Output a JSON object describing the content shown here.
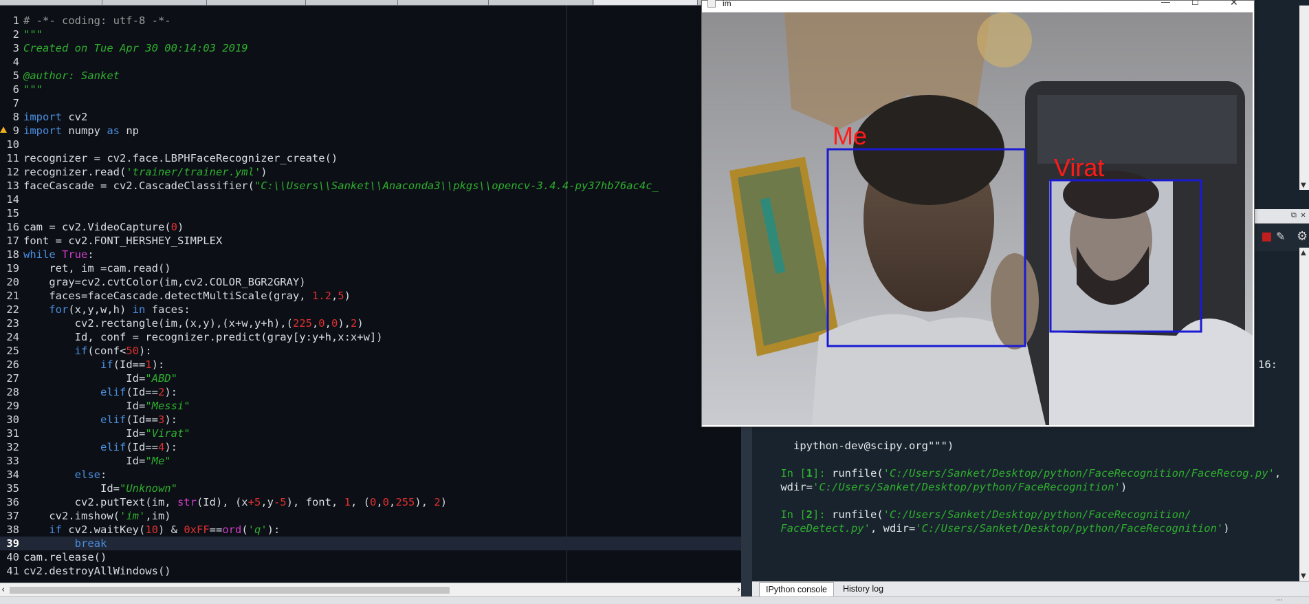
{
  "editor": {
    "current_line": 39,
    "lines": [
      {
        "n": "1",
        "html": "<span class=\"c\"># -*- coding: utf-8 -*-</span>"
      },
      {
        "n": "2",
        "html": "<span class=\"s\">\"\"\"</span>"
      },
      {
        "n": "3",
        "html": "<span class=\"s\">Created on Tue Apr 30 00:14:03 2019</span>"
      },
      {
        "n": "4",
        "html": ""
      },
      {
        "n": "5",
        "html": "<span class=\"s\">@author: Sanket</span>"
      },
      {
        "n": "6",
        "html": "<span class=\"s\">\"\"\"</span>"
      },
      {
        "n": "7",
        "html": ""
      },
      {
        "n": "8",
        "html": "<span class=\"k\">import</span> cv2"
      },
      {
        "n": "9",
        "html": "<span class=\"k\">import</span> numpy <span class=\"k\">as</span> np"
      },
      {
        "n": "10",
        "html": ""
      },
      {
        "n": "11",
        "html": "recognizer = cv2.face.LBPHFaceRecognizer_create()"
      },
      {
        "n": "12",
        "html": "recognizer.read(<span class=\"s\">'trainer/trainer.yml'</span>)"
      },
      {
        "n": "13",
        "html": "faceCascade = cv2.CascadeClassifier(<span class=\"s\">\"C:\\\\Users\\\\Sanket\\\\Anaconda3\\\\pkgs\\\\opencv-3.4.4-py37hb76ac4c_</span>"
      },
      {
        "n": "14",
        "html": ""
      },
      {
        "n": "15",
        "html": ""
      },
      {
        "n": "16",
        "html": "cam = cv2.VideoCapture(<span class=\"n\">0</span>)"
      },
      {
        "n": "17",
        "html": "font = cv2.FONT_HERSHEY_SIMPLEX"
      },
      {
        "n": "18",
        "html": "<span class=\"k\">while</span> <span class=\"k2\">True</span>:"
      },
      {
        "n": "19",
        "html": "    ret, im =cam.read()"
      },
      {
        "n": "20",
        "html": "    gray=cv2.cvtColor(im,cv2.COLOR_BGR2GRAY)"
      },
      {
        "n": "21",
        "html": "    faces=faceCascade.detectMultiScale(gray, <span class=\"n\">1.2</span>,<span class=\"n\">5</span>)"
      },
      {
        "n": "22",
        "html": "    <span class=\"k\">for</span>(x,y,w,h) <span class=\"k\">in</span> faces:"
      },
      {
        "n": "23",
        "html": "        cv2.rectangle(im,(x,y),(x+w,y+h),(<span class=\"n\">225</span>,<span class=\"n\">0</span>,<span class=\"n\">0</span>),<span class=\"n\">2</span>)"
      },
      {
        "n": "24",
        "html": "        Id, conf = recognizer.predict(gray[y:y+h,x:x+w])"
      },
      {
        "n": "25",
        "html": "        <span class=\"k\">if</span>(conf&lt;<span class=\"n\">50</span>):"
      },
      {
        "n": "26",
        "html": "            <span class=\"k\">if</span>(Id==<span class=\"n\">1</span>):"
      },
      {
        "n": "27",
        "html": "                Id=<span class=\"s\">\"ABD\"</span>"
      },
      {
        "n": "28",
        "html": "            <span class=\"k\">elif</span>(Id==<span class=\"n\">2</span>):"
      },
      {
        "n": "29",
        "html": "                Id=<span class=\"s\">\"Messi\"</span>"
      },
      {
        "n": "30",
        "html": "            <span class=\"k\">elif</span>(Id==<span class=\"n\">3</span>):"
      },
      {
        "n": "31",
        "html": "                Id=<span class=\"s\">\"Virat\"</span>"
      },
      {
        "n": "32",
        "html": "            <span class=\"k\">elif</span>(Id==<span class=\"n\">4</span>):"
      },
      {
        "n": "33",
        "html": "                Id=<span class=\"s\">\"Me\"</span>"
      },
      {
        "n": "34",
        "html": "        <span class=\"k\">else</span>:"
      },
      {
        "n": "35",
        "html": "            Id=<span class=\"s\">\"Unknown\"</span>"
      },
      {
        "n": "36",
        "html": "        cv2.putText(im, <span class=\"k2\">str</span>(Id), (x<span class=\"n\">+5</span>,y<span class=\"n\">-5</span>), font, <span class=\"n\">1</span>, (<span class=\"n\">0</span>,<span class=\"n\">0</span>,<span class=\"n\">255</span>), <span class=\"n\">2</span>)"
      },
      {
        "n": "37",
        "html": "    cv2.imshow(<span class=\"s\">'im'</span>,im)"
      },
      {
        "n": "38",
        "html": "    <span class=\"k\">if</span> cv2.waitKey(<span class=\"n\">10</span>) &amp; <span class=\"n\">0xFF</span>==<span class=\"k2\">ord</span>(<span class=\"s\">'q'</span>):"
      },
      {
        "n": "39",
        "html": "        <span class=\"k\">break</span>"
      },
      {
        "n": "40",
        "html": "cam.release()"
      },
      {
        "n": "41",
        "html": "cv2.destroyAllWindows()"
      }
    ]
  },
  "image_window": {
    "title": "im",
    "labels": {
      "me": "Me",
      "virat": "Virat"
    },
    "box_color": "#1a1ad2",
    "label_color": "#ff1a1a"
  },
  "console": {
    "fragments": {
      "bracket": "]",
      "partial": "16:"
    },
    "email_line": "  ipython-dev@scipy.org\"\"\")",
    "in1_prompt_a": "In [",
    "in1_num": "1",
    "in1_prompt_b": "]: ",
    "in1_cmd": "runfile(",
    "in1_path": "'C:/Users/Sanket/Desktop/python/FaceRecognition/FaceRecog.py'",
    "in1_tail": ",",
    "in1_wdir": "wdir=",
    "in1_wdir_path": "'C:/Users/Sanket/Desktop/python/FaceRecognition'",
    "in1_close": ")",
    "in2_prompt_a": "In [",
    "in2_num": "2",
    "in2_prompt_b": "]: ",
    "in2_cmd": "runfile(",
    "in2_path": "'C:/Users/Sanket/Desktop/python/FaceRecognition/",
    "in2_path2": "FaceDetect.py'",
    "in2_mid": ", wdir=",
    "in2_wdir_path": "'C:/Users/Sanket/Desktop/python/FaceRecognition'",
    "in2_close": ")"
  },
  "bottom_tabs": {
    "ipython": "IPython console",
    "history": "History log"
  }
}
